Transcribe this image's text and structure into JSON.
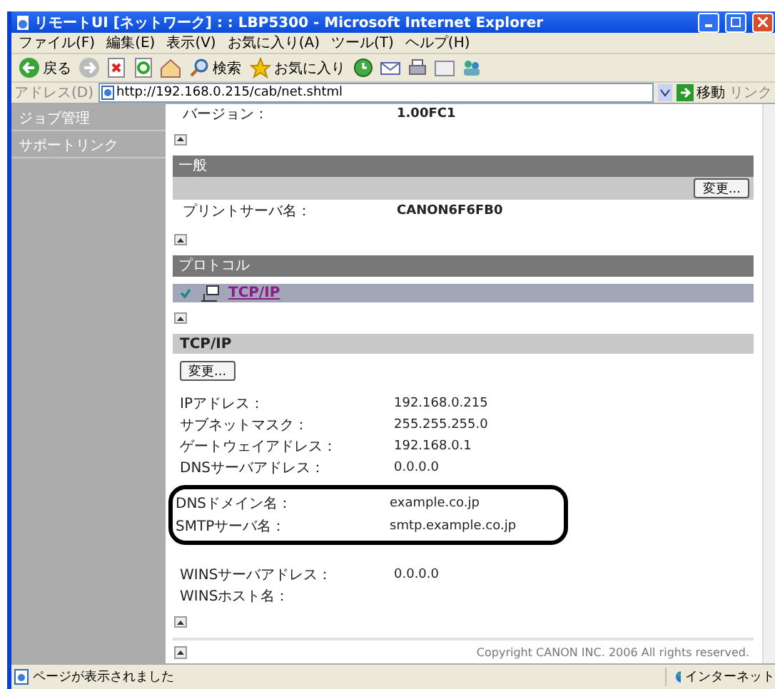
{
  "window": {
    "title": "リモートUI [ネットワーク] : : LBP5300 - Microsoft Internet Explorer"
  },
  "menu": [
    "ファイル(F)",
    "編集(E)",
    "表示(V)",
    "お気に入り(A)",
    "ツール(T)",
    "ヘルプ(H)"
  ],
  "toolbar": {
    "back": "戻る",
    "search": "検索",
    "favorites": "お気に入り"
  },
  "address_bar": {
    "label": "アドレス(D)",
    "url": "http://192.168.0.215/cab/net.shtml",
    "go": "移動",
    "links": "リンク"
  },
  "sidebar": {
    "items": [
      {
        "label": "ジョブ管理"
      },
      {
        "label": "サポートリンク"
      }
    ]
  },
  "content": {
    "version_row": {
      "label": "バージョン：",
      "value": "1.00FC1"
    },
    "general": {
      "title": "一般",
      "button": "変更...",
      "rows": [
        {
          "label": "プリントサーバ名：",
          "value": "CANON6F6FB0"
        }
      ]
    },
    "protocol": {
      "title": "プロトコル",
      "items": [
        {
          "label": "TCP/IP",
          "checked": true
        }
      ]
    },
    "tcpip": {
      "title": "TCP/IP",
      "button": "変更...",
      "groups": [
        {
          "highlighted": false,
          "rows": [
            {
              "label": "IPアドレス：",
              "value": "192.168.0.215"
            },
            {
              "label": "サブネットマスク：",
              "value": "255.255.255.0"
            },
            {
              "label": "ゲートウェイアドレス：",
              "value": "192.168.0.1"
            },
            {
              "label": "DNSサーバアドレス：",
              "value": "0.0.0.0"
            }
          ]
        },
        {
          "highlighted": true,
          "rows": [
            {
              "label": "DNSドメイン名：",
              "value": "example.co.jp"
            },
            {
              "label": "SMTPサーバ名：",
              "value": "smtp.example.co.jp"
            }
          ]
        },
        {
          "highlighted": false,
          "rows": [
            {
              "label": "WINSサーバアドレス：",
              "value": "0.0.0.0"
            },
            {
              "label": "WINSホスト名："
            }
          ]
        }
      ]
    }
  },
  "footer": {
    "copyright": "Copyright CANON INC. 2006 All rights reserved."
  },
  "status_bar": {
    "message": "ページが表示されました",
    "zone": "インターネット"
  }
}
